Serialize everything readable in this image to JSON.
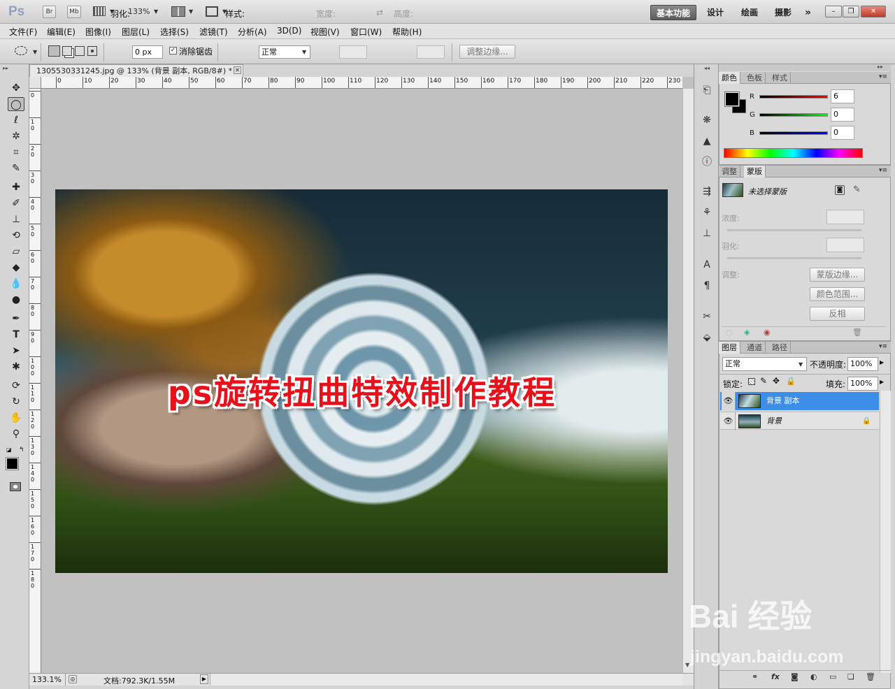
{
  "app": {
    "logo": "Ps",
    "bridge_label": "Br",
    "minibridge_label": "Mb",
    "zoom_level": "133%"
  },
  "workspaces": [
    "基本功能",
    "设计",
    "绘画",
    "摄影",
    "»"
  ],
  "menu": [
    "文件(F)",
    "编辑(E)",
    "图像(I)",
    "图层(L)",
    "选择(S)",
    "滤镜(T)",
    "分析(A)",
    "3D(D)",
    "视图(V)",
    "窗口(W)",
    "帮助(H)"
  ],
  "options": {
    "feather_label": "羽化:",
    "feather_value": "0 px",
    "antialias_label": "消除锯齿",
    "antialias_checked": true,
    "style_label": "样式:",
    "style_value": "正常",
    "width_label": "宽度:",
    "height_label": "高度:",
    "refine_edge": "调整边缘..."
  },
  "document": {
    "tab_title": "1305530331245.jpg @ 133% (背景 副本, RGB/8#) *",
    "image_text": "ps旋转扭曲特效制作教程",
    "zoom_status": "133.1%",
    "doc_info": "文档:792.3K/1.55M"
  },
  "ruler": {
    "h": [
      "0",
      "10",
      "20",
      "30",
      "40",
      "50",
      "60",
      "70",
      "80",
      "90",
      "100",
      "110",
      "120",
      "130",
      "140",
      "150",
      "160",
      "170",
      "180",
      "190",
      "200",
      "210",
      "220",
      "230"
    ],
    "v": [
      "0",
      "1 0",
      "2 0",
      "3 0",
      "4 0",
      "5 0",
      "6 0",
      "7 0",
      "8 0",
      "9 0",
      "1 0 0",
      "1 1 0",
      "1 2 0",
      "1 3 0",
      "1 4 0",
      "1 5 0",
      "1 6 0",
      "1 7 0",
      "1 8 0"
    ]
  },
  "color_panel": {
    "tabs": [
      "颜色",
      "色板",
      "样式"
    ],
    "r_label": "R",
    "r_value": "6",
    "g_label": "G",
    "g_value": "0",
    "b_label": "B",
    "b_value": "0"
  },
  "masks_panel": {
    "tabs": [
      "调整",
      "蒙版"
    ],
    "no_mask": "未选择蒙版",
    "density_label": "浓度:",
    "feather_label": "羽化:",
    "refine_label": "调整:",
    "mask_edge": "蒙版边缘...",
    "color_range": "颜色范围...",
    "invert": "反相"
  },
  "layers_panel": {
    "tabs": [
      "图层",
      "通道",
      "路径"
    ],
    "blend_mode": "正常",
    "opacity_label": "不透明度:",
    "opacity_value": "100%",
    "lock_label": "锁定:",
    "fill_label": "填充:",
    "fill_value": "100%",
    "layers": [
      {
        "name": "背景 副本",
        "selected": true
      },
      {
        "name": "背景",
        "selected": false
      }
    ]
  },
  "watermark": {
    "brand": "Bai 经验",
    "url": "jingyan.baidu.com"
  },
  "colors": {
    "accent_selected": "#3d8ee8",
    "title_red": "#e8101a"
  }
}
